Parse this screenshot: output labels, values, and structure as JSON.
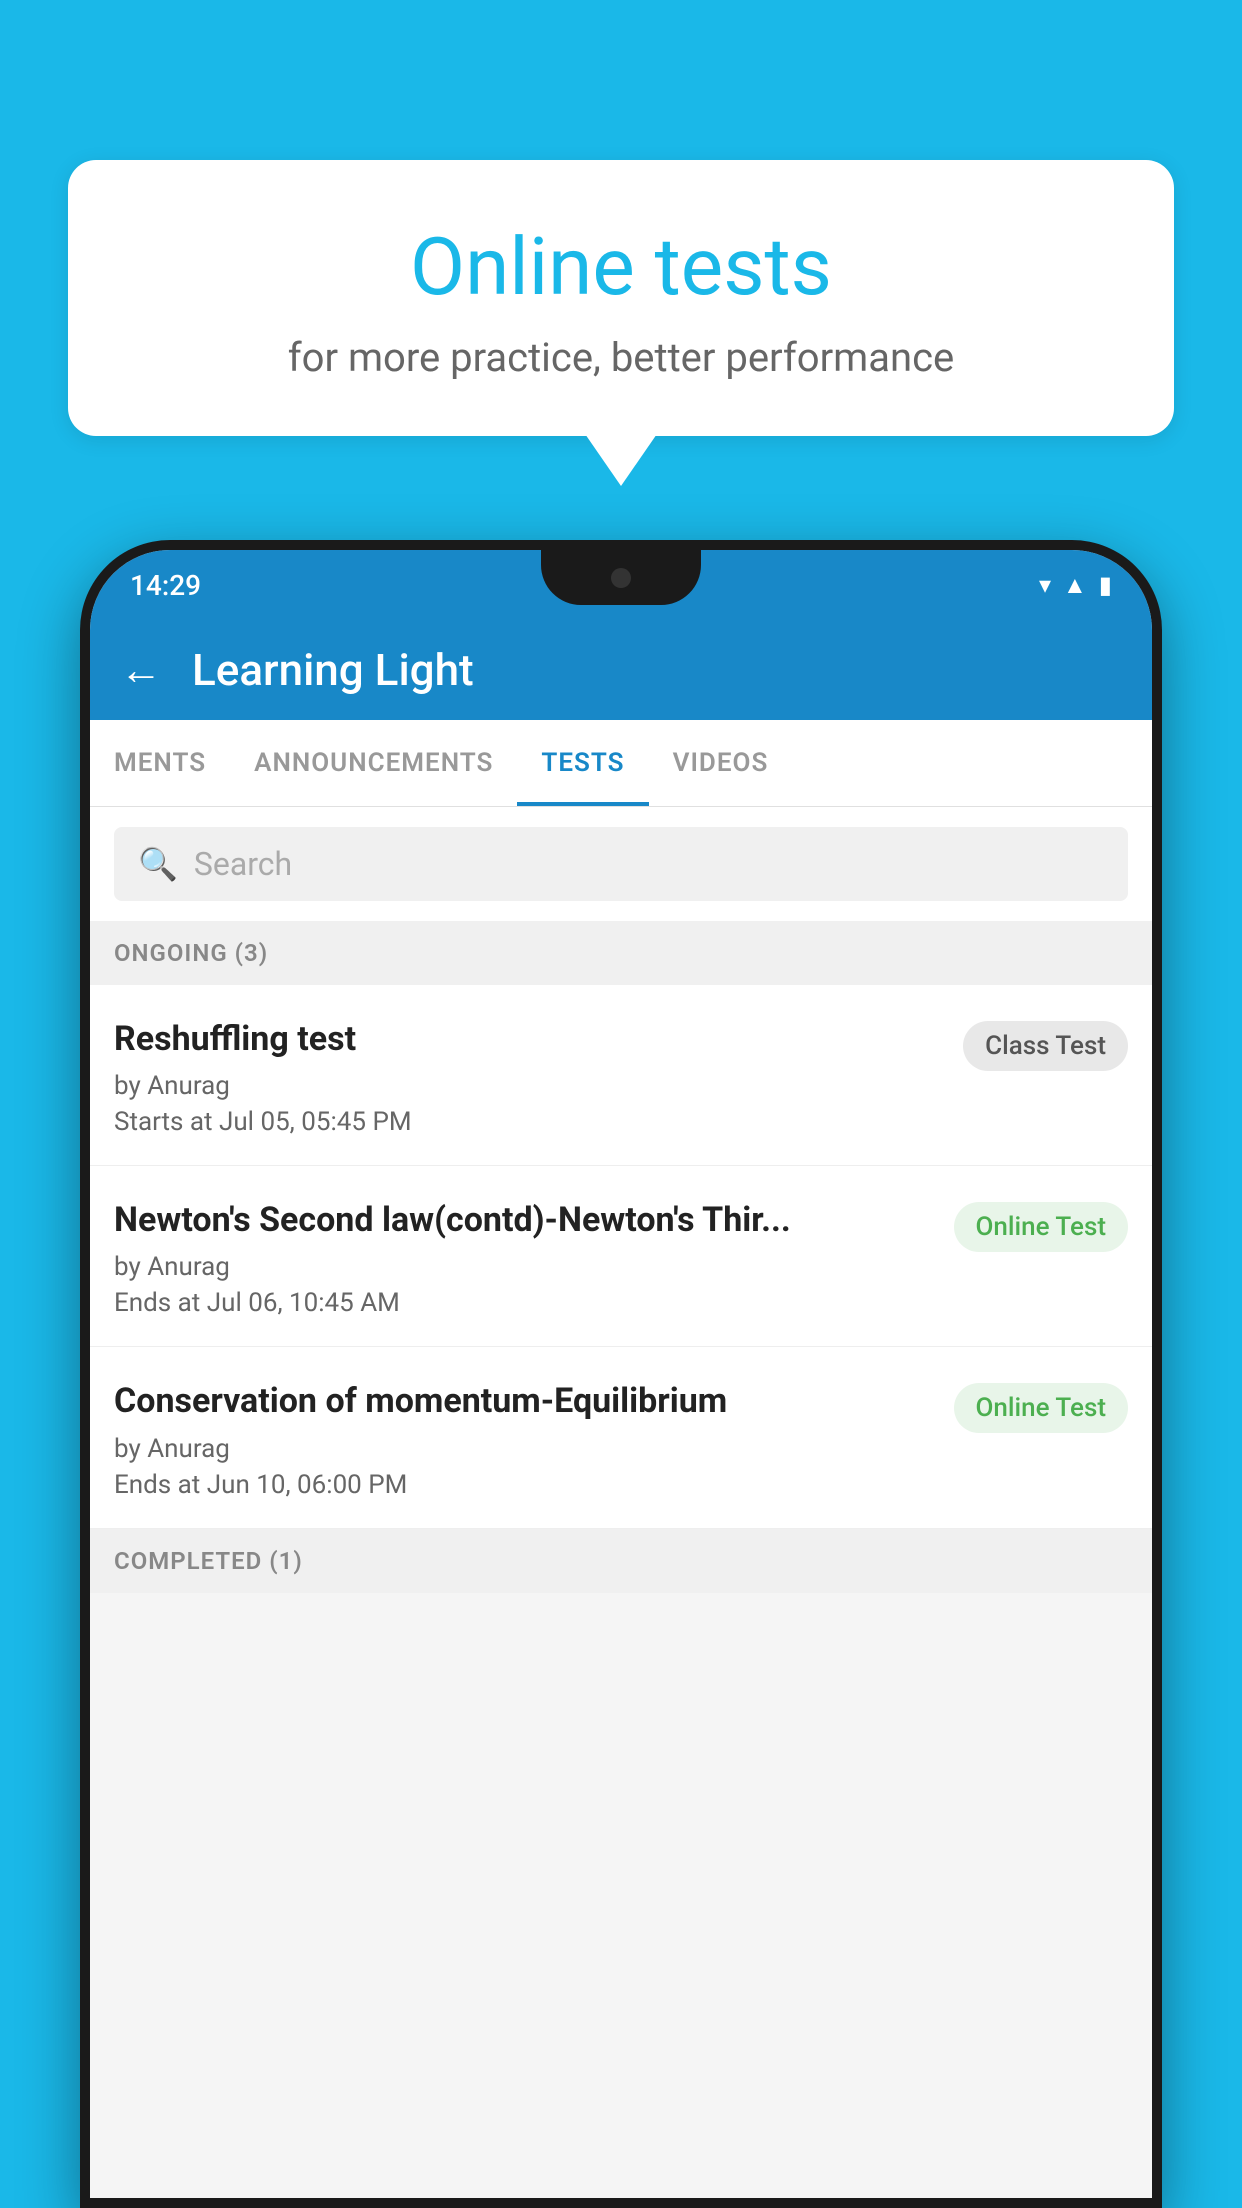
{
  "background_color": "#1ab8e8",
  "bubble": {
    "title": "Online tests",
    "subtitle": "for more practice, better performance"
  },
  "phone": {
    "status_bar": {
      "time": "14:29",
      "icons": [
        "wifi",
        "signal",
        "battery"
      ]
    },
    "header": {
      "back_label": "←",
      "title": "Learning Light"
    },
    "tabs": [
      {
        "label": "MENTS",
        "active": false
      },
      {
        "label": "ANNOUNCEMENTS",
        "active": false
      },
      {
        "label": "TESTS",
        "active": true
      },
      {
        "label": "VIDEOS",
        "active": false
      }
    ],
    "search": {
      "placeholder": "Search"
    },
    "ongoing_section": {
      "label": "ONGOING (3)",
      "items": [
        {
          "title": "Reshuffling test",
          "by": "by Anurag",
          "date": "Starts at  Jul 05, 05:45 PM",
          "badge": "Class Test",
          "badge_type": "class"
        },
        {
          "title": "Newton's Second law(contd)-Newton's Thir...",
          "by": "by Anurag",
          "date": "Ends at  Jul 06, 10:45 AM",
          "badge": "Online Test",
          "badge_type": "online"
        },
        {
          "title": "Conservation of momentum-Equilibrium",
          "by": "by Anurag",
          "date": "Ends at  Jun 10, 06:00 PM",
          "badge": "Online Test",
          "badge_type": "online"
        }
      ]
    },
    "completed_section": {
      "label": "COMPLETED (1)"
    }
  }
}
